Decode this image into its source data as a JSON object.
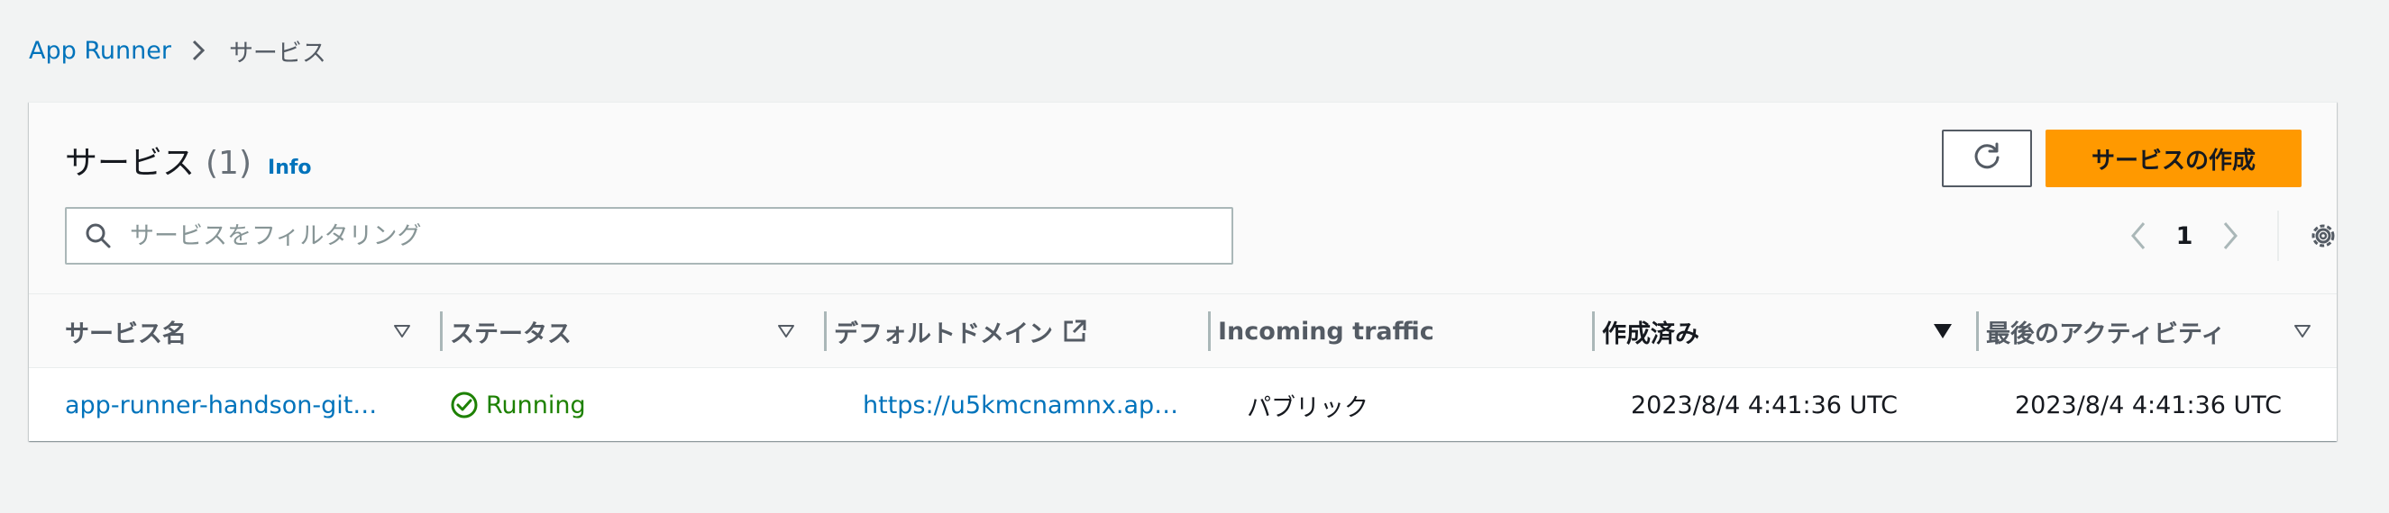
{
  "breadcrumb": {
    "items": [
      "App Runner",
      "サービス"
    ]
  },
  "panel": {
    "title": "サービス",
    "count": "(1)",
    "info_label": "Info",
    "create_button_label": "サービスの作成",
    "search": {
      "placeholder": "サービスをフィルタリング",
      "value": ""
    },
    "pagination": {
      "current_page": "1"
    }
  },
  "table": {
    "columns": [
      {
        "label": "サービス名",
        "sorted": false
      },
      {
        "label": "ステータス",
        "sorted": false
      },
      {
        "label": "デフォルトドメイン",
        "sorted": false,
        "external_icon": true
      },
      {
        "label": "Incoming traffic",
        "sortable": false
      },
      {
        "label": "作成済み",
        "sorted": true,
        "direction": "descending"
      },
      {
        "label": "最後のアクティビティ",
        "sorted": false
      }
    ],
    "rows": [
      {
        "service_name": "app-runner-handson-git…",
        "status": "Running",
        "default_domain": "https://u5kmcnamnx.ap…",
        "incoming_traffic": "パブリック",
        "created": "2023/8/4 4:41:36 UTC",
        "last_activity": "2023/8/4 4:41:36 UTC"
      }
    ]
  },
  "colors": {
    "link": "#0073bb",
    "primary_button": "#ff9900",
    "status_success": "#1d8102",
    "page_background": "#f2f3f3"
  },
  "icons": [
    "chevron-right-icon",
    "refresh-icon",
    "search-icon",
    "chevron-left-icon",
    "settings-gear-icon",
    "sort-caret-icon",
    "external-link-icon",
    "status-check-icon"
  ]
}
